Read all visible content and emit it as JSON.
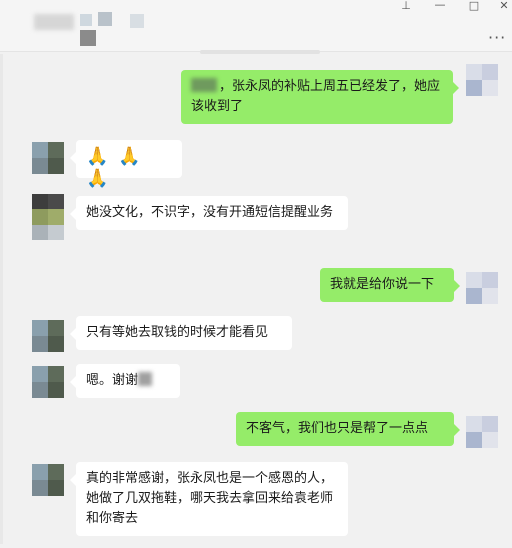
{
  "window": {
    "controls": {
      "pin": "⊥",
      "minimize": "—",
      "maximize": "□",
      "close": "✕",
      "more": "···"
    }
  },
  "messages": [
    {
      "side": "out",
      "name_blurred": true,
      "text": "，张永凤的补贴上周五已经发了，她应该收到了"
    },
    {
      "side": "in",
      "text": "🙏🙏🙏",
      "emoji": [
        "praying-hands",
        "praying-hands",
        "praying-hands"
      ]
    },
    {
      "side": "in",
      "text": "她没文化，不识字，没有开通短信提醒业务"
    },
    {
      "side": "out",
      "text": "我就是给你说一下"
    },
    {
      "side": "in",
      "text": "只有等她去取钱的时候才能看见"
    },
    {
      "side": "in",
      "text": "嗯。谢谢",
      "tail_blurred": true
    },
    {
      "side": "out",
      "text": "不客气，我们也只是帮了一点点"
    },
    {
      "side": "in",
      "text": "真的非常感谢，张永凤也是一个感恩的人，她做了几双拖鞋，哪天我去拿回来给袁老师和你寄去"
    }
  ],
  "colors": {
    "outgoing_bubble": "#95ec69",
    "incoming_bubble": "#ffffff",
    "background": "#f1f1f1"
  }
}
